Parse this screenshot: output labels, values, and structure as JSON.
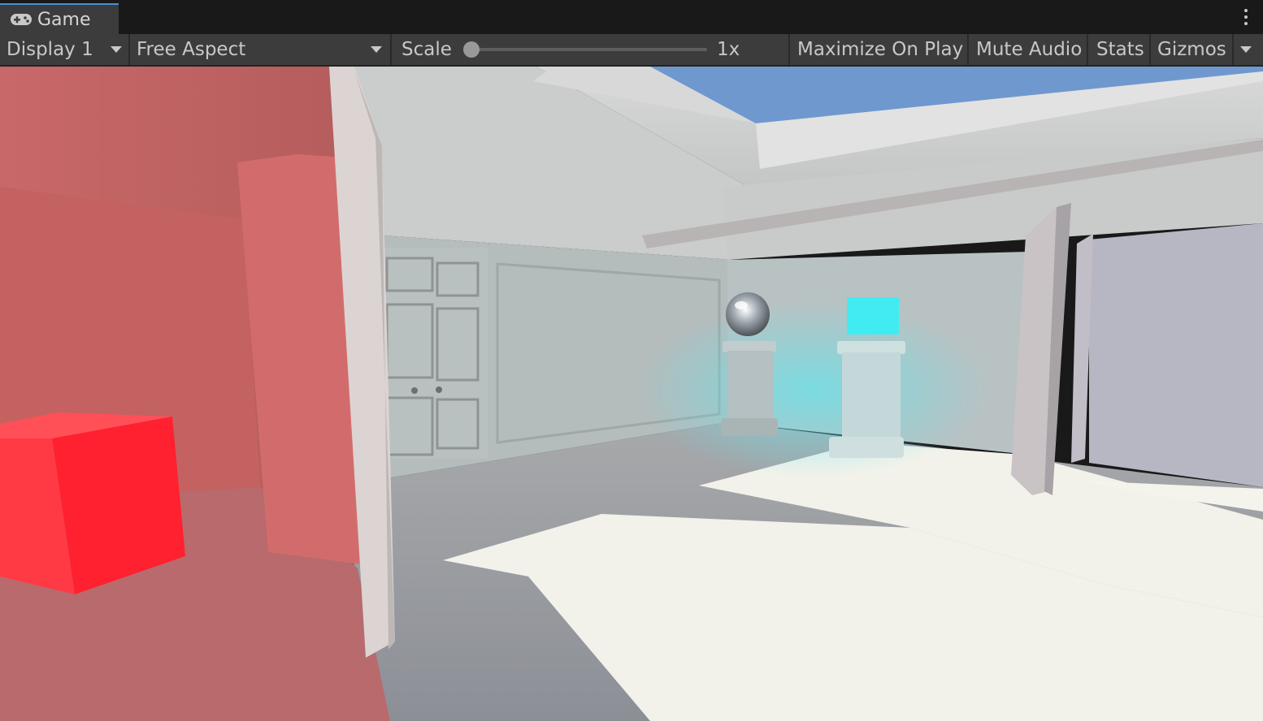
{
  "tab": {
    "label": "Game",
    "icon": "gamepad-icon"
  },
  "toolbar": {
    "display_label": "Display 1",
    "aspect_label": "Free Aspect",
    "scale_label": "Scale",
    "scale_value": "1x",
    "scale_level": 0.0,
    "maximize_label": "Maximize On Play",
    "mute_label": "Mute Audio",
    "stats_label": "Stats",
    "gizmos_label": "Gizmos"
  },
  "scene": {
    "description_objects": [
      "red-cube",
      "mirror-sphere",
      "cyan-glow-cube",
      "pedestal-left",
      "pedestal-right",
      "double-door",
      "skylight"
    ],
    "colors": {
      "red_cube": "#ff2030",
      "cyan_cube": "#40ecf2",
      "floor_light": "#f2f1ea",
      "wall_red": "#cf6a6a",
      "sky": "#6f98cf"
    }
  }
}
